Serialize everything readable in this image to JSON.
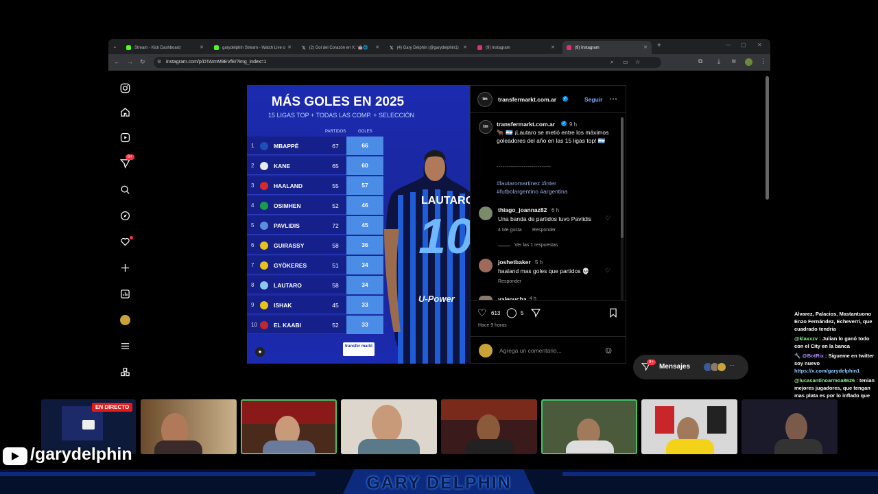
{
  "browser": {
    "tabs": [
      {
        "label": "Stream - Kick Dashboard",
        "favicon": "kick",
        "color": "#53fc18"
      },
      {
        "label": "garydelphin Stream - Watch Live o",
        "favicon": "kick",
        "color": "#53fc18"
      },
      {
        "label": "(2) Gol del Corazón en X: '🤖🌐",
        "favicon": "x",
        "color": "#ffffff"
      },
      {
        "label": "(4) Gary Delphin (@garydelphin1)",
        "favicon": "x",
        "color": "#ffffff"
      },
      {
        "label": "(9) Instagram",
        "favicon": "instagram",
        "color": "#e1306c"
      },
      {
        "label": "(9) Instagram",
        "favicon": "instagram",
        "color": "#e1306c"
      }
    ],
    "url": "instagram.com/p/DTAtmM9EVfE/?img_index=1"
  },
  "instagram": {
    "sidebar_badge": "9+",
    "graphic": {
      "title": "MÁS GOLES EN 2025",
      "subtitle": "15 LIGAS TOP + TODAS LAS COMP. + SELECCIÓN",
      "col_partidos": "PARTIDOS",
      "col_goles": "GOLES",
      "rows": [
        {
          "rank": "1",
          "name": "MBAPPÉ",
          "partidos": "67",
          "goles": "66",
          "flag": "#1f4fb5"
        },
        {
          "rank": "2",
          "name": "KANE",
          "partidos": "65",
          "goles": "60",
          "flag": "#e8e8e8"
        },
        {
          "rank": "3",
          "name": "HAALAND",
          "partidos": "55",
          "goles": "57",
          "flag": "#d42a2a"
        },
        {
          "rank": "4",
          "name": "OSIMHEN",
          "partidos": "52",
          "goles": "46",
          "flag": "#1b9c4a"
        },
        {
          "rank": "5",
          "name": "PAVLIDIS",
          "partidos": "72",
          "goles": "45",
          "flag": "#5b8fd9"
        },
        {
          "rank": "6",
          "name": "GUIRASSY",
          "partidos": "58",
          "goles": "36",
          "flag": "#e8c21c"
        },
        {
          "rank": "7",
          "name": "GYÖKERES",
          "partidos": "51",
          "goles": "34",
          "flag": "#e8c21c"
        },
        {
          "rank": "8",
          "name": "LAUTARO",
          "partidos": "58",
          "goles": "34",
          "flag": "#8ec6f0"
        },
        {
          "rank": "9",
          "name": "ISHAK",
          "partidos": "45",
          "goles": "33",
          "flag": "#e8c21c"
        },
        {
          "rank": "10",
          "name": "EL KAABI",
          "partidos": "52",
          "goles": "33",
          "flag": "#c1272d"
        }
      ],
      "player_name": "LAUTARO",
      "player_number": "10",
      "sponsor": "U-Power",
      "brand_logo": "transfer markt"
    },
    "post": {
      "account": "transfermarkt.com.ar",
      "follow": "Seguir",
      "caption_time": "9 h",
      "caption": "🐂 🇦🇷 ¡Lautaro se metió entre los máximos goleadores del año en las 15 ligas top! 🇦🇷",
      "separator": "----------------------------",
      "hashtags": "#lautaromartinez #inter #futbolargentino #argentina",
      "comments": [
        {
          "user": "thiago_joannaz82",
          "time": "6 h",
          "text": "Una banda de partidos tuvo Pavlidis",
          "likes": "4 Me gusta",
          "reply": "Responder",
          "replies": "Ver las 1 respuestas"
        },
        {
          "user": "joshetbaker",
          "time": "5 h",
          "text": "haaland mas goles que partidos 💀",
          "reply": "Responder"
        },
        {
          "user": "valepucha",
          "time": "4 h"
        }
      ],
      "likes_count": "613",
      "comments_count": "5",
      "posted_ago": "Hace 9 horas",
      "comment_placeholder": "Agrega un comentario..."
    },
    "messages": {
      "label": "Mensajes",
      "badge": "9+"
    }
  },
  "stream": {
    "live_label": "EN DIRECTO",
    "handle": "/garydelphin",
    "footer_name": "GARY DELPHIN",
    "chat": [
      {
        "text": "Alvarez, Palacios, Mastantuono Enzo Fernández, Echeverri, que cuadrado tendria"
      },
      {
        "user": "@klaxxzv",
        "text": ": Julian lo ganó todo con el City en la banca"
      },
      {
        "user": "🔧 @BotRix",
        "text": ": Sigueme en twitter soy nuevo",
        "link": "https://x.com/garydelphin1"
      },
      {
        "user": "@lucasantinoarmoa8626",
        "text": ": tenian mejores jugadores, que tengan mas plata es por lo inflado que esta el mercado"
      }
    ]
  }
}
